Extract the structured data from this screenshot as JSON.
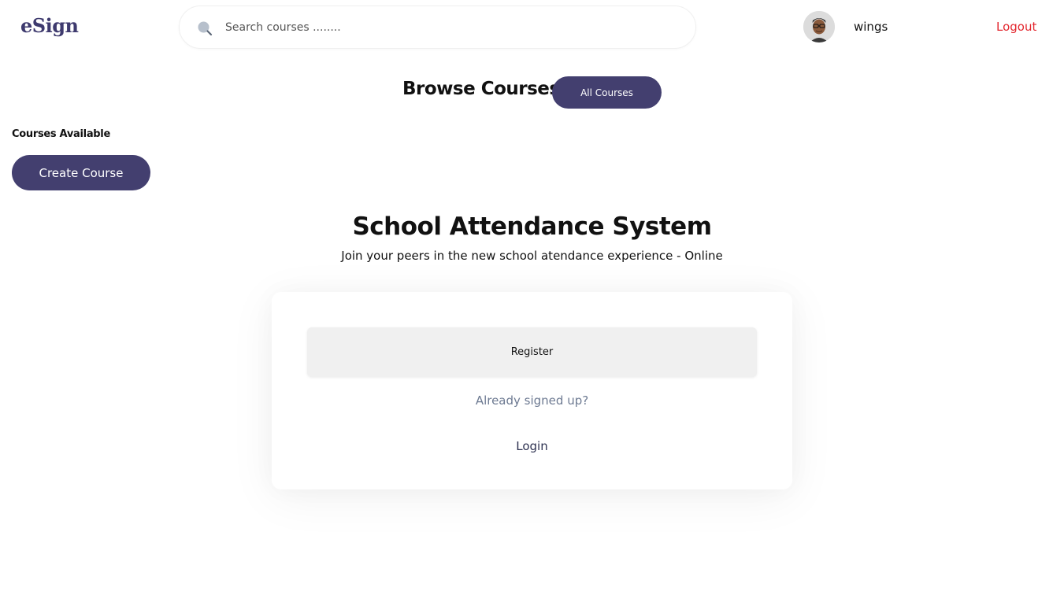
{
  "header": {
    "logo": "eSign",
    "search": {
      "placeholder": "Search courses ........"
    },
    "user": {
      "name": "wings"
    },
    "logout_label": "Logout"
  },
  "browse": {
    "title": "Browse Courses",
    "all_courses_label": "All Courses"
  },
  "sidebar": {
    "courses_available_label": "Courses Available",
    "create_course_label": "Create Course"
  },
  "hero": {
    "title": "School Attendance System",
    "subtitle": "Join your peers in the new school atendance experience - Online"
  },
  "card": {
    "register_label": "Register",
    "signed_up_text": "Already signed up?",
    "login_label": "Login"
  },
  "colors": {
    "brand": "#433f6f",
    "logout": "#e3262e",
    "muted_text": "#6d7a92"
  }
}
